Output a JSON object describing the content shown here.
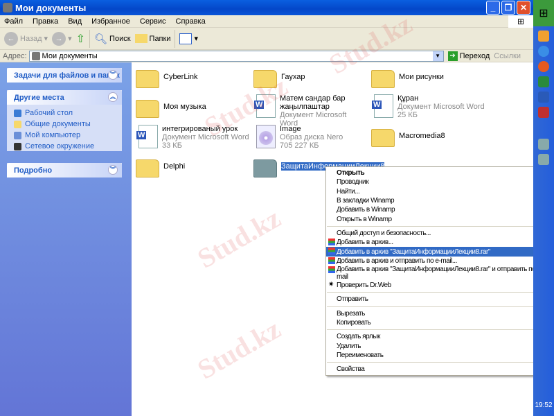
{
  "window": {
    "title": "Мои документы"
  },
  "menubar": [
    "Файл",
    "Правка",
    "Вид",
    "Избранное",
    "Сервис",
    "Справка"
  ],
  "toolbar": {
    "back": "Назад",
    "search": "Поиск",
    "folders": "Папки"
  },
  "address": {
    "label": "Адрес:",
    "value": "Мои документы",
    "go": "Переход",
    "links": "Ссылки"
  },
  "sidebar": {
    "tasks": "Задачи для файлов и папок",
    "other": "Другие места",
    "other_items": [
      "Рабочий стол",
      "Общие документы",
      "Мой компьютер",
      "Сетевое окружение"
    ],
    "details": "Подробно"
  },
  "files": [
    {
      "name": "CyberLink",
      "type": "folder"
    },
    {
      "name": "Гаухар",
      "type": "folder"
    },
    {
      "name": "Мои рисунки",
      "type": "folder"
    },
    {
      "name": "Моя музыка",
      "type": "folder"
    },
    {
      "name": "Матем сандар бар жаңылпаштар",
      "sub": "Документ Microsoft Word",
      "type": "doc"
    },
    {
      "name": "Құран",
      "sub": "Документ Microsoft Word",
      "size": "25 КБ",
      "type": "doc"
    },
    {
      "name": "интегрированый урок",
      "sub": "Документ Microsoft Word",
      "size": "33 КБ",
      "type": "doc"
    },
    {
      "name": "Image",
      "sub": "Образ диска Nero",
      "size": "705 227 КБ",
      "type": "cd"
    },
    {
      "name": "Macromedia8",
      "type": "folder"
    },
    {
      "name": "Delphi",
      "type": "folder"
    },
    {
      "name": "ЗащитаИнформацииЛекции8",
      "type": "folder"
    }
  ],
  "context_menu": {
    "g1": [
      "Открыть",
      "Проводник",
      "Найти...",
      "В закладки Winamp",
      "Добавить в Winamp",
      "Открыть в Winamp"
    ],
    "g2": [
      "Общий доступ и безопасность...",
      "Добавить в архив...",
      "Добавить в архив \"ЗащитаИнформацииЛекции8.rar\"",
      "Добавить в архив и отправить по e-mail...",
      "Добавить в архив \"ЗащитаИнформацииЛекции8.rar\" и отправить по e-mail",
      "Проверить Dr.Web"
    ],
    "g3": [
      "Отправить"
    ],
    "g4": [
      "Вырезать",
      "Копировать"
    ],
    "g5": [
      "Создать ярлык",
      "Удалить",
      "Переименовать"
    ],
    "g6": [
      "Свойства"
    ]
  },
  "taskbar": {
    "clock": "19:52"
  },
  "watermark": "Stud.kz"
}
